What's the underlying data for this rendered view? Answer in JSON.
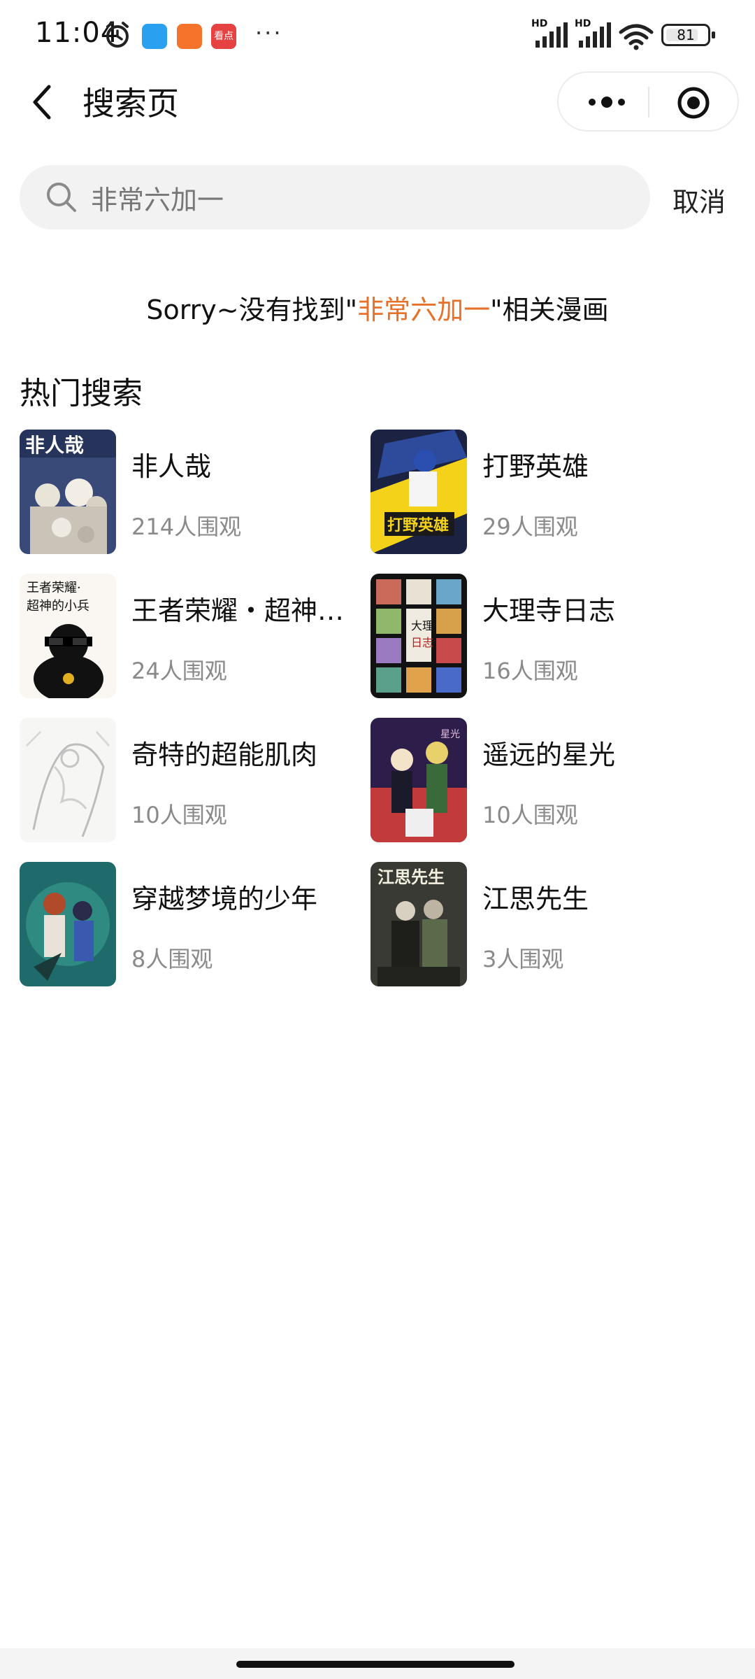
{
  "status_bar": {
    "time": "11:04",
    "badge_red_text": "看点",
    "more": "···",
    "hd1": "HD",
    "hd2": "HD",
    "battery": "81",
    "battery_level": 0.81
  },
  "nav": {
    "title": "搜索页"
  },
  "search": {
    "query": "非常六加一",
    "cancel_label": "取消"
  },
  "no_result": {
    "prefix": "Sorry~没有找到\"",
    "keyword": "非常六加一",
    "suffix": "\"相关漫画"
  },
  "hot": {
    "title": "热门搜索",
    "items": [
      {
        "title": "非人哉",
        "views": "214人围观"
      },
      {
        "title": "打野英雄",
        "views": "29人围观"
      },
      {
        "title": "王者荣耀・超神…",
        "views": "24人围观"
      },
      {
        "title": "大理寺日志",
        "views": "16人围观"
      },
      {
        "title": "奇特的超能肌肉",
        "views": "10人围观"
      },
      {
        "title": "遥远的星光",
        "views": "10人围观"
      },
      {
        "title": "穿越梦境的少年",
        "views": "8人围观"
      },
      {
        "title": "江思先生",
        "views": "3人围观"
      }
    ]
  },
  "colors": {
    "accent": "#e8712a",
    "muted": "#8a8a8a",
    "search_bg": "#f2f2f2"
  }
}
